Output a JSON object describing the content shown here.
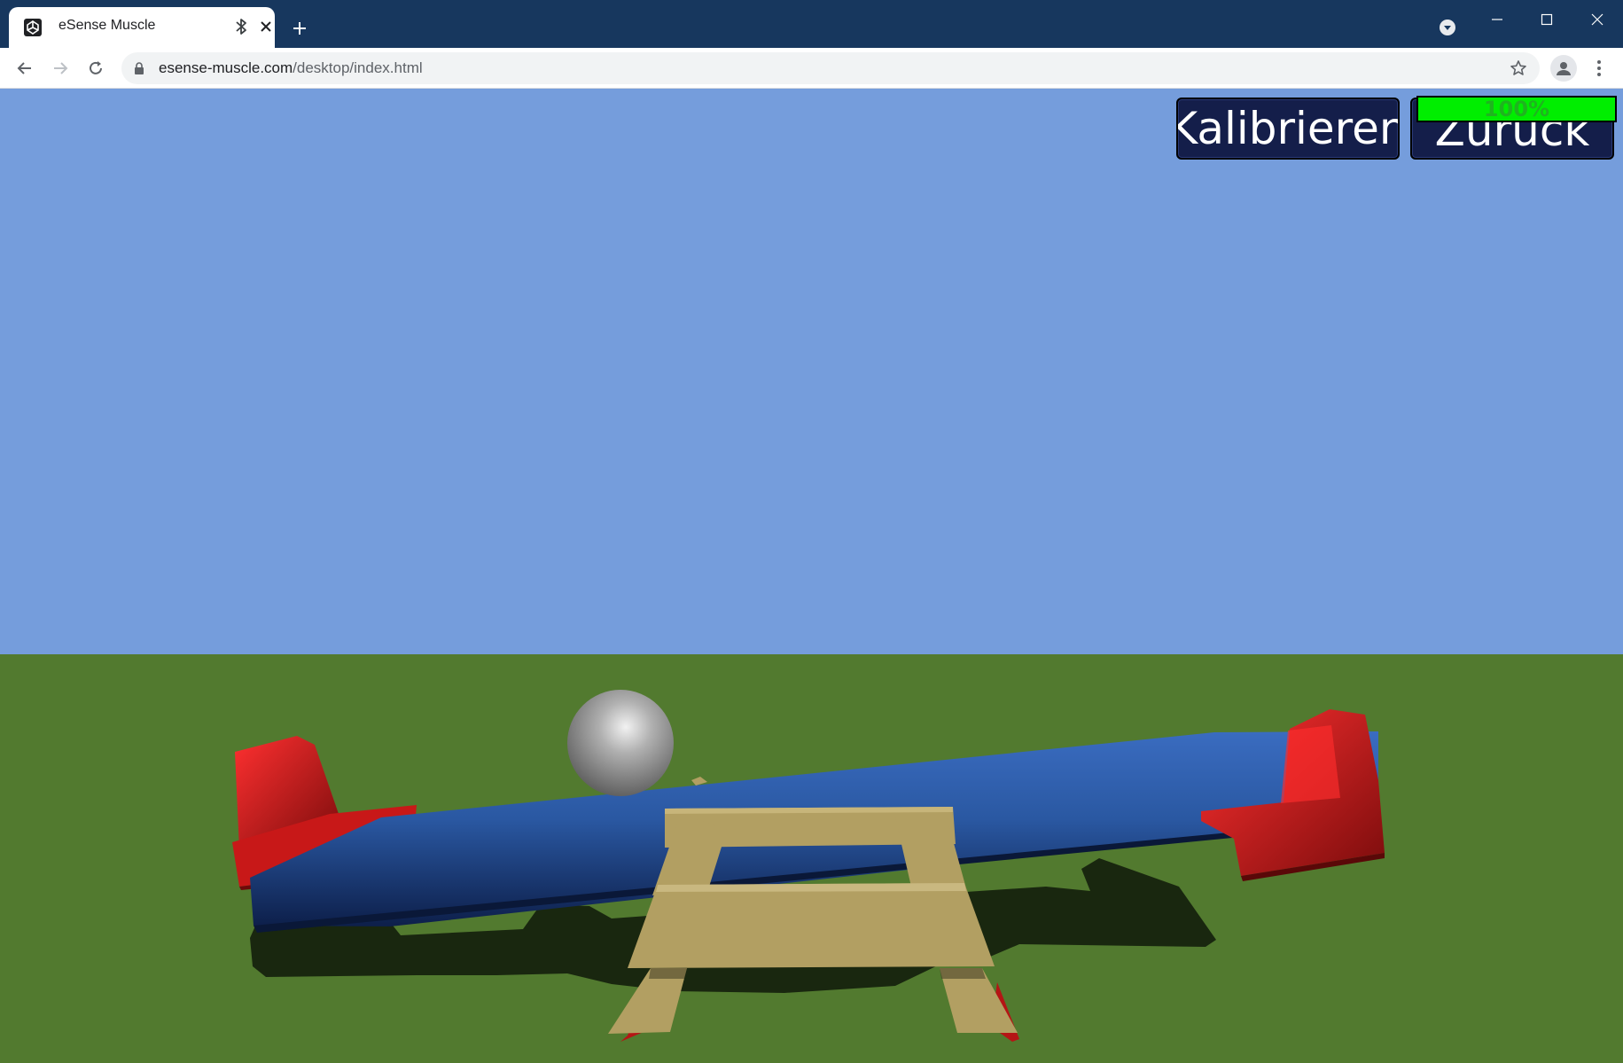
{
  "browser": {
    "tab": {
      "title": "eSense Muscle",
      "favicon": "unity-icon",
      "bluetooth_indicator": "bluetooth-icon",
      "close_icon": "close-icon"
    },
    "new_tab_icon": "plus-icon",
    "window_controls": [
      "minimize-icon",
      "maximize-icon",
      "close-icon"
    ],
    "profile_dropdown_icon": "chevron-down-icon",
    "address_bar": {
      "secure_icon": "lock-icon",
      "domain": "esense-muscle.com",
      "path": "/desktop/index.html"
    },
    "nav_icons": [
      "back-arrow-icon",
      "forward-arrow-icon",
      "reload-icon"
    ],
    "bookmark_icon": "star-icon",
    "account_icon": "person-icon",
    "menu_icon": "kebab-menu-icon"
  },
  "game": {
    "buttons": {
      "calibrate_label": "Kalibrieren",
      "back_label": "Zurück"
    },
    "progress": {
      "value": 1.0,
      "label": "100%"
    },
    "colors": {
      "sky": "#759ddc",
      "ground": "#527a2f",
      "seesaw_beam": "#2c5aa0",
      "seats": "#d81f1f",
      "stand": "#b29f62",
      "ball": "#9a9a9a",
      "button_bg": "#141e4a",
      "progress_fill": "#00ee00"
    }
  }
}
